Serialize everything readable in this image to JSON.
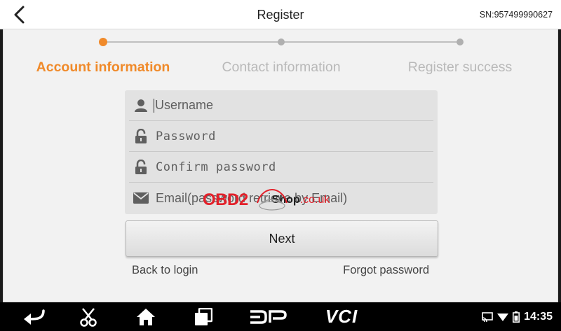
{
  "header": {
    "title": "Register",
    "serial": "SN:957499990627",
    "back_icon": "chevron-left-icon"
  },
  "steps": [
    {
      "label": "Account information",
      "state": "active"
    },
    {
      "label": "Contact information",
      "state": "inactive"
    },
    {
      "label": "Register success",
      "state": "inactive"
    }
  ],
  "form": {
    "username_placeholder": "Username",
    "password_placeholder": "Password",
    "confirm_placeholder": "Confirm password",
    "email_placeholder": "Email(password retrieve by Email)"
  },
  "actions": {
    "next_label": "Next",
    "back_to_login": "Back to login",
    "forgot_password": "Forgot password"
  },
  "watermark": {
    "brand": "OBD2",
    "shop": "Shop",
    "domain": ".co.uk"
  },
  "navbar": {
    "dp_label": "DP",
    "vci_label": "VCI",
    "time": "14:35"
  },
  "colors": {
    "accent": "#f08a2a",
    "inactive": "#b9b9b9",
    "watermark_red": "#e3202a"
  }
}
